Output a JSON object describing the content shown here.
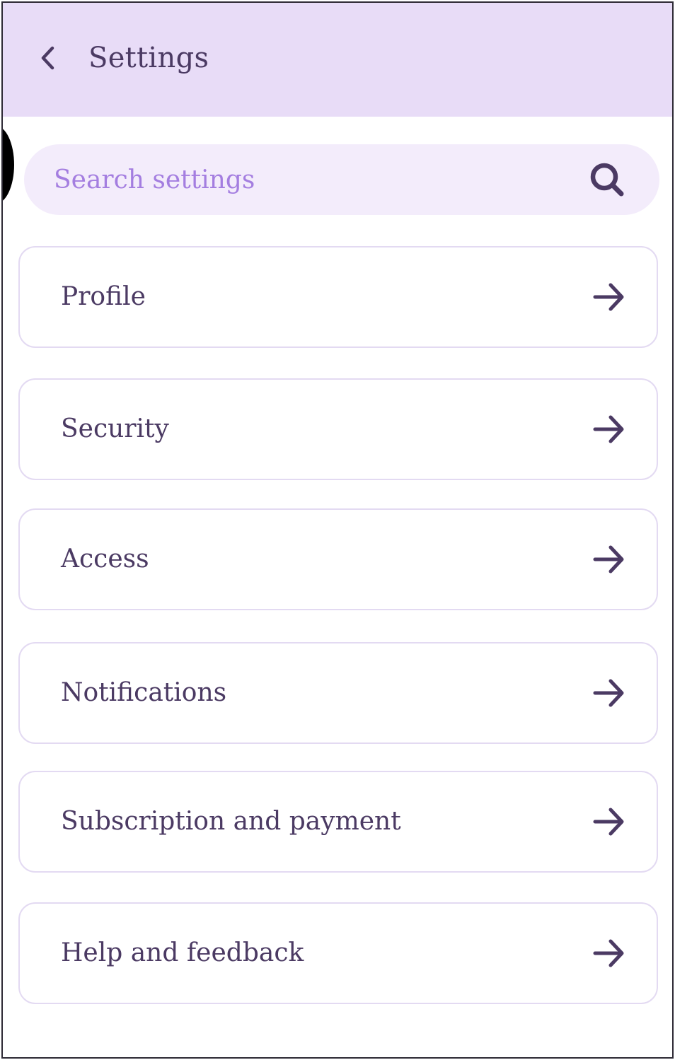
{
  "header": {
    "title": "Settings",
    "back_icon": "chevron-left-icon"
  },
  "search": {
    "placeholder": "Search settings",
    "value": "",
    "icon": "search-icon"
  },
  "settings_items": [
    {
      "label": "Profile",
      "icon": "arrow-right-icon"
    },
    {
      "label": "Security",
      "icon": "arrow-right-icon"
    },
    {
      "label": "Access",
      "icon": "arrow-right-icon"
    },
    {
      "label": "Notifications",
      "icon": "arrow-right-icon"
    },
    {
      "label": "Subscription and payment",
      "icon": "arrow-right-icon"
    },
    {
      "label": "Help and feedback",
      "icon": "arrow-right-icon"
    }
  ],
  "colors": {
    "header_background": "#e8dcf7",
    "search_background": "#f3ecfb",
    "placeholder": "#a47ee0",
    "text": "#4b3a63",
    "item_border": "#e3daf2"
  }
}
